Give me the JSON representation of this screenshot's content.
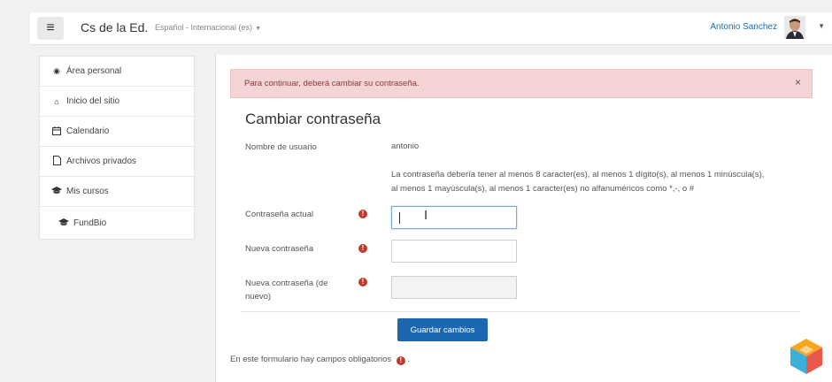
{
  "navbar": {
    "menu_icon": "hamburger-icon",
    "brand": "Cs de la Ed.",
    "language": "Español - Internacional (es)",
    "username": "Antonio Sanchez"
  },
  "sidebar": {
    "items": [
      {
        "label": "Área personal",
        "icon": "dashboard-icon"
      },
      {
        "label": "Inicio del sitio",
        "icon": "home-icon"
      },
      {
        "label": "Calendario",
        "icon": "calendar-icon"
      },
      {
        "label": "Archivos privados",
        "icon": "file-icon"
      },
      {
        "label": "Mis cursos",
        "icon": "graduation-cap-icon"
      },
      {
        "label": "FundBio",
        "icon": "graduation-cap-icon"
      }
    ]
  },
  "alert": {
    "text": "Para continuar, deberá cambiar su contraseña.",
    "close": "×"
  },
  "form": {
    "title": "Cambiar contraseña",
    "username_label": "Nombre de usuario",
    "username_value": "antonio",
    "hint_line1": "La contraseña debería tener al menos 8 caracter(es), al menos 1 dígito(s), al menos 1 minúscula(s),",
    "hint_line2": "al menos 1 mayúscula(s), al menos 1 caracter(es) no alfanuméricos como *,-, o #",
    "current_label": "Contraseña actual",
    "new_label": "Nueva contraseña",
    "confirm_label_line1": "Nueva contraseña (de",
    "confirm_label_line2": "nuevo)",
    "save_button": "Guardar cambios",
    "required_note": "En este formulario hay campos obligatorios",
    "required_note_end": "."
  },
  "colors": {
    "alert_bg": "#f4d4d4",
    "primary": "#1b68b0",
    "required": "#c0392b"
  }
}
